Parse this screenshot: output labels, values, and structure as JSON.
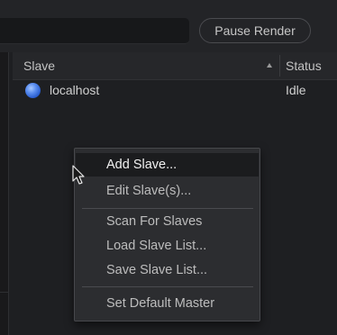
{
  "toolbar": {
    "pause_label": "Pause Render"
  },
  "table": {
    "columns": [
      "Slave",
      "Status"
    ],
    "rows": [
      {
        "host": "localhost",
        "status": "Idle",
        "status_color": "#4f86ec"
      }
    ]
  },
  "context_menu": {
    "items": [
      {
        "label": "Add Slave...",
        "active": true
      },
      {
        "label": "Edit Slave(s)..."
      },
      {
        "label": "Scan For Slaves"
      },
      {
        "label": "Load Slave List..."
      },
      {
        "label": "Save Slave List..."
      },
      {
        "label": "Set Default Master"
      }
    ]
  },
  "icons": {
    "sort": "sort-ascending-icon",
    "status": "status-dot-icon",
    "cursor": "mouse-pointer-icon"
  }
}
